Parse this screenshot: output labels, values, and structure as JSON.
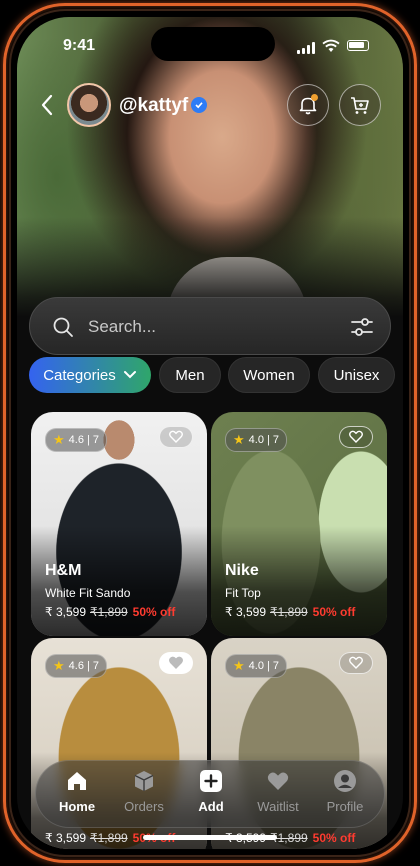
{
  "status_bar": {
    "time": "9:41"
  },
  "header": {
    "username": "@kattyf"
  },
  "search": {
    "placeholder": "Search..."
  },
  "chips": [
    {
      "label": "Categories"
    },
    {
      "label": "Men"
    },
    {
      "label": "Women"
    },
    {
      "label": "Unisex"
    }
  ],
  "products": [
    {
      "rating": "4.6 | 7",
      "brand": "H&M",
      "name": "White Fit Sando",
      "price": "₹ 3,599",
      "old_price": "₹1,899",
      "discount": "50% off"
    },
    {
      "rating": "4.0 | 7",
      "brand": "Nike",
      "name": "Fit Top",
      "price": "₹ 3,599",
      "old_price": "₹1,899",
      "discount": "50% off"
    },
    {
      "rating": "4.6 | 7",
      "brand": "",
      "name": "",
      "price": "₹ 3,599",
      "old_price": "₹1,899",
      "discount": "50% off"
    },
    {
      "rating": "4.0 | 7",
      "brand": "",
      "name": "",
      "price": "₹ 3,599",
      "old_price": "₹1,899",
      "discount": "50% off"
    }
  ],
  "nav": [
    {
      "label": "Home",
      "icon": "home-icon",
      "active": true
    },
    {
      "label": "Orders",
      "icon": "box-icon",
      "active": false
    },
    {
      "label": "Add",
      "icon": "plus-icon",
      "active": true
    },
    {
      "label": "Waitlist",
      "icon": "heart-icon",
      "active": false
    },
    {
      "label": "Profile",
      "icon": "user-icon",
      "active": false
    }
  ],
  "colors": {
    "accent_start": "#3463f0",
    "accent_end": "#2fa66a",
    "discount": "#ff3b30",
    "frame": "#e0632a",
    "star": "#f5c518"
  }
}
